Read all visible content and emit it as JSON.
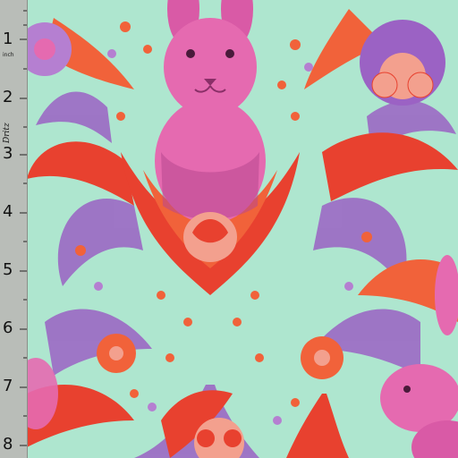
{
  "ruler": {
    "numbers": [
      "1",
      "2",
      "3",
      "4",
      "5",
      "6",
      "7",
      "8"
    ],
    "inch_label": "inch",
    "brand": "Dritz"
  },
  "colors": {
    "background": "#aee6cf",
    "rabbit_pink": "#e56ab0",
    "rabbit_shadow": "#b8478f",
    "leaf_red": "#e8412f",
    "leaf_orange": "#f1623a",
    "leaf_purple": "#9b62c4",
    "flower_peach": "#f3a08e",
    "ruler_gray": "#b9bdb8"
  }
}
